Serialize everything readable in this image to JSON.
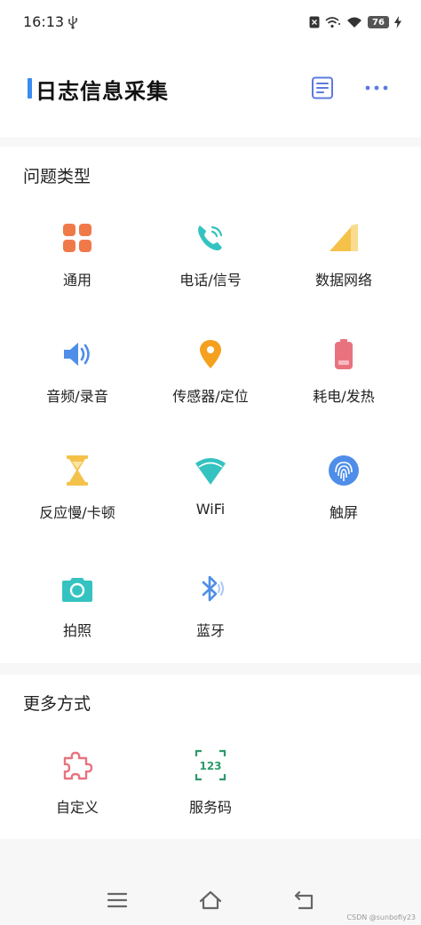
{
  "status_bar": {
    "time": "16:13",
    "battery": "76",
    "icons": [
      "usb-icon",
      "sim-missing-icon",
      "wifi-hotspot-icon",
      "wifi-icon",
      "battery-icon",
      "charging-icon"
    ]
  },
  "header": {
    "title": "日志信息采集",
    "accent_color": "#3b8cf0",
    "icons": [
      "document-icon",
      "more-icon"
    ]
  },
  "problem_section": {
    "title": "问题类型",
    "items": [
      {
        "label": "通用",
        "icon": "grid-apps-icon"
      },
      {
        "label": "电话/信号",
        "icon": "phone-icon"
      },
      {
        "label": "数据网络",
        "icon": "signal-icon"
      },
      {
        "label": "音频/录音",
        "icon": "speaker-icon"
      },
      {
        "label": "传感器/定位",
        "icon": "location-pin-icon"
      },
      {
        "label": "耗电/发热",
        "icon": "battery-icon"
      },
      {
        "label": "反应慢/卡顿",
        "icon": "hourglass-icon"
      },
      {
        "label": "WiFi",
        "icon": "wifi-icon"
      },
      {
        "label": "触屏",
        "icon": "fingerprint-icon"
      },
      {
        "label": "拍照",
        "icon": "camera-icon"
      },
      {
        "label": "蓝牙",
        "icon": "bluetooth-icon"
      }
    ]
  },
  "more_section": {
    "title": "更多方式",
    "items": [
      {
        "label": "自定义",
        "icon": "puzzle-icon"
      },
      {
        "label": "服务码",
        "icon": "service-code-icon",
        "code": "123"
      }
    ]
  },
  "nav_bar": {
    "icons": [
      "menu-icon",
      "home-icon",
      "back-icon"
    ]
  },
  "watermark": "CSDN @sunbofiy23",
  "colors": {
    "orange": "#f0794a",
    "teal": "#34c3c0",
    "gold": "#f4c24a",
    "blue": "#4f8ee8",
    "pink": "#e8737f",
    "green": "#2e9a6a"
  }
}
